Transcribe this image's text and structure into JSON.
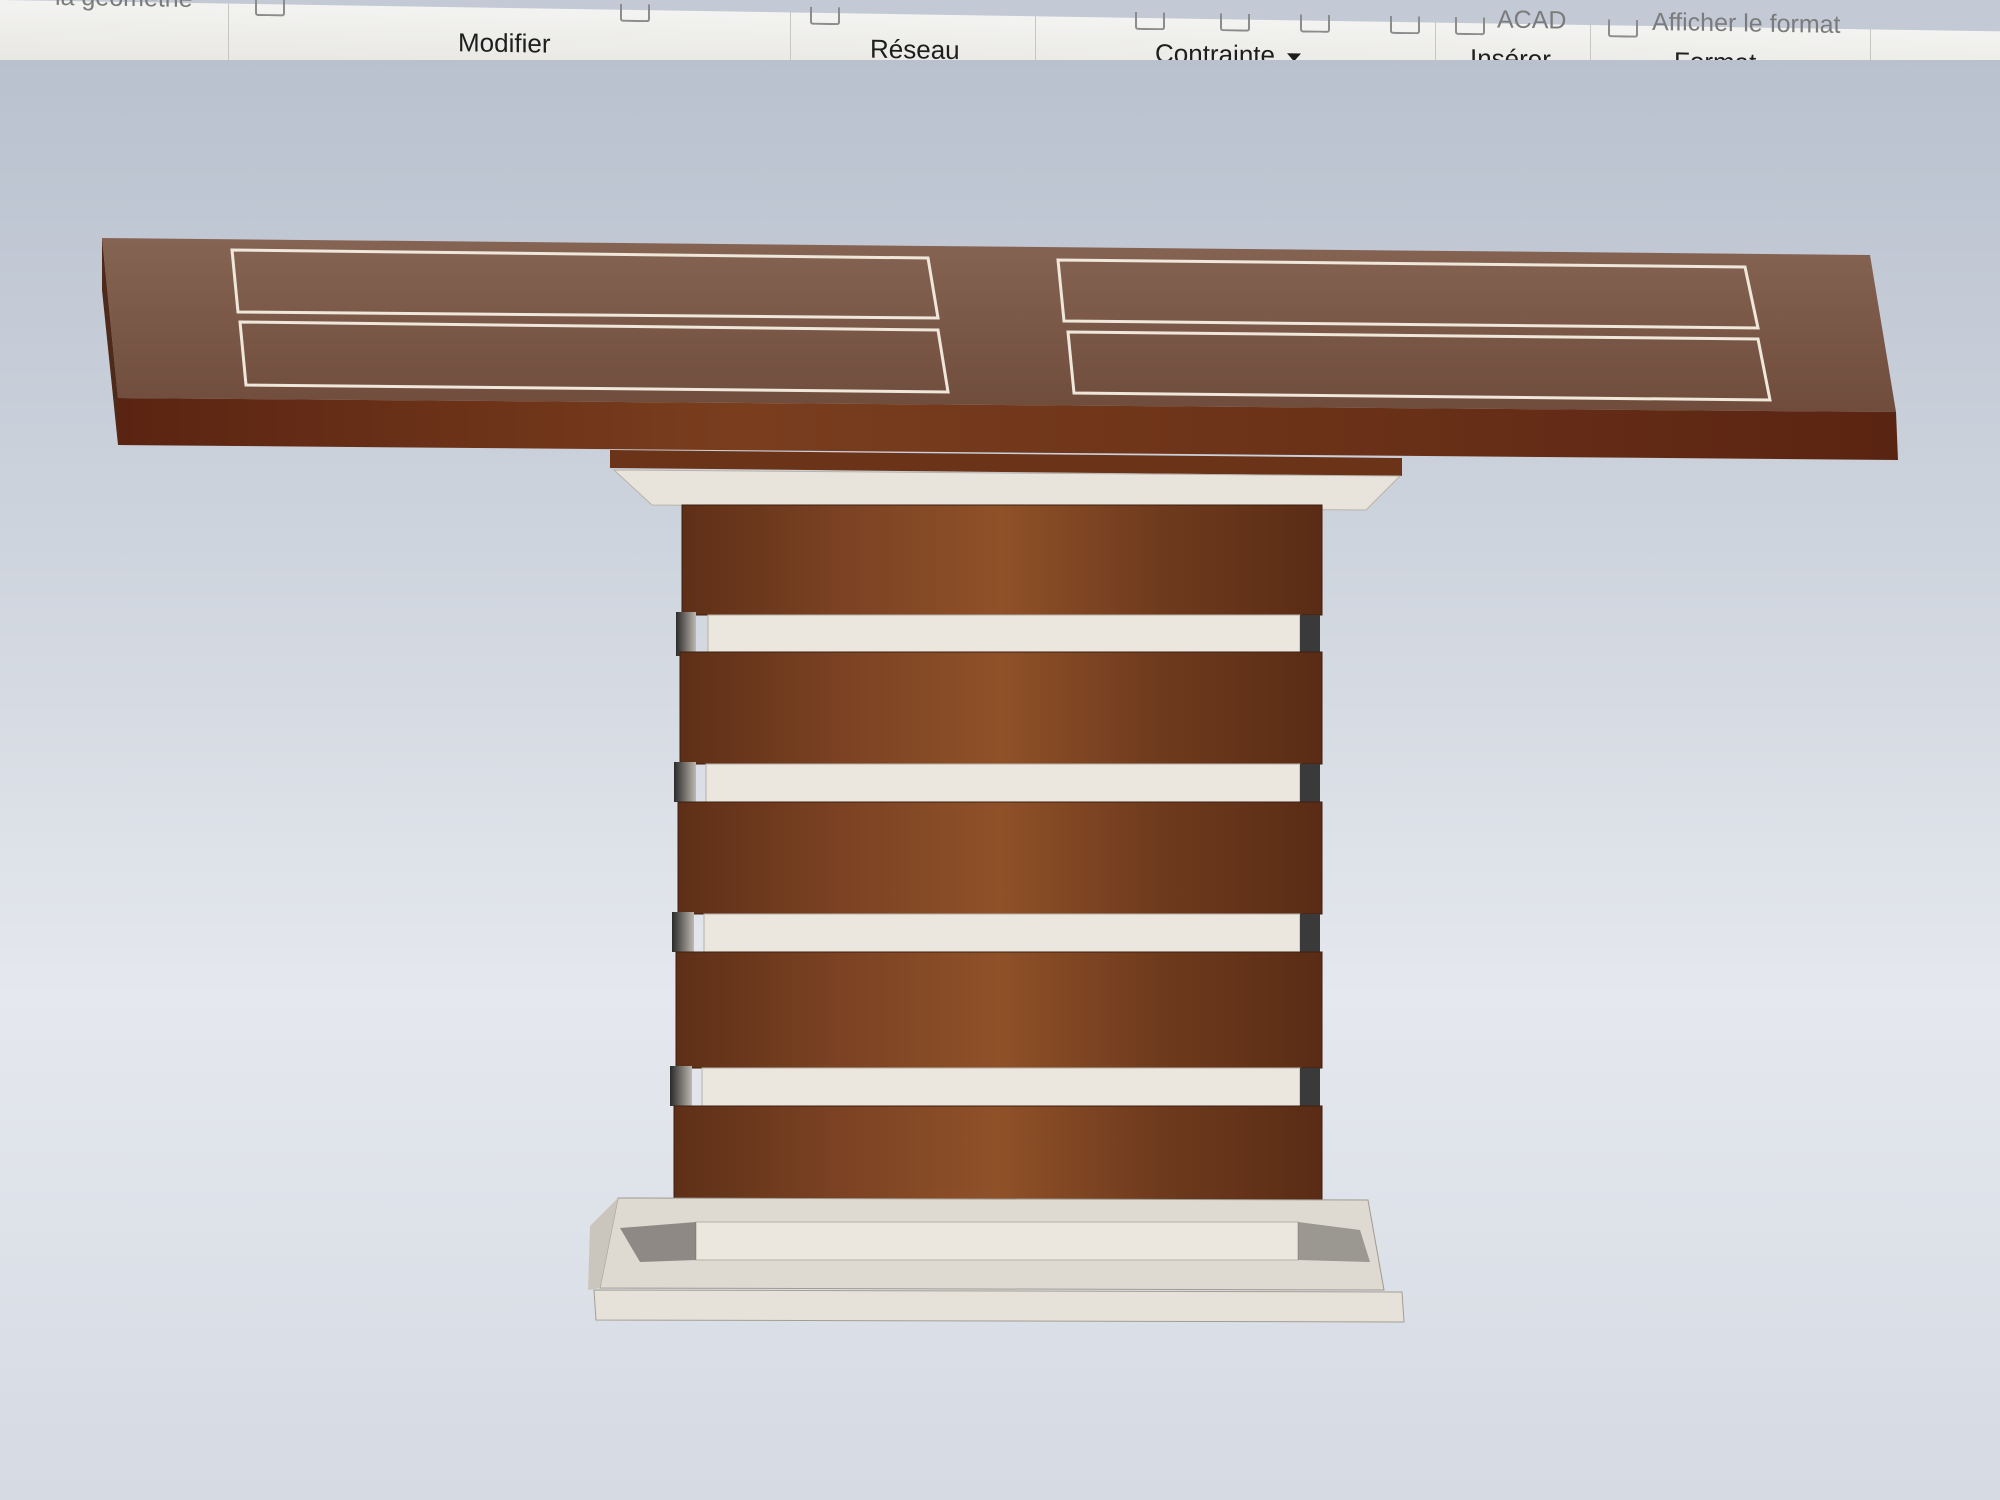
{
  "ribbon": {
    "panels": [
      {
        "label": "Modifier",
        "has_dropdown": false
      },
      {
        "label": "Réseau",
        "has_dropdown": false
      },
      {
        "label": "Contrainte",
        "has_dropdown": true
      },
      {
        "label": "Insérer",
        "has_dropdown": false
      },
      {
        "label": "Format",
        "has_dropdown": true
      }
    ],
    "partial_tools": {
      "geometry": "la géométrie",
      "acad": "ACAD",
      "show_format": "Afficher le format"
    }
  },
  "viewport": {
    "model": "console-table-3d",
    "wood_color": "#6b3a1f",
    "top_color": "#7a5a4a",
    "spacer_color": "#ece8e0",
    "background_color": "#c9cfd9"
  }
}
